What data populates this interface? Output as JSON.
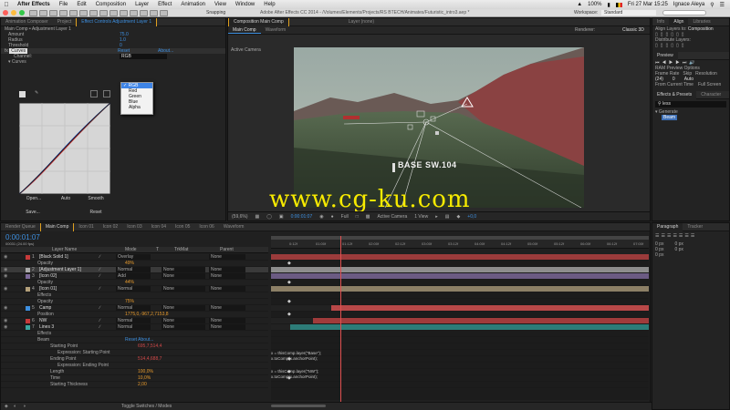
{
  "menubar": {
    "apple": "",
    "app": "After Effects",
    "items": [
      "File",
      "Edit",
      "Composition",
      "Layer",
      "Effect",
      "Animation",
      "View",
      "Window",
      "Help"
    ],
    "battery": "100%",
    "date": "Fri 27 Mar 15:25",
    "user": "Ignace Aleya"
  },
  "titlebar": {
    "title": "Adobe After Effects CC 2014 - /Volumes/Elements/Projects/RS BTECH/Animates/Futuristic_intro3.aep *",
    "snapping": "Snapping",
    "workspace_label": "Workspace:",
    "workspace_value": "Standard"
  },
  "left_panel": {
    "tabs": [
      "Animation Composer",
      "Project",
      "Effect Controls Adjustment Layer 1"
    ],
    "header": "Main Comp • Adjustment Layer 1",
    "props": [
      {
        "label": "Amount",
        "value": "75.0"
      },
      {
        "label": "Radius",
        "value": "1.0"
      },
      {
        "label": "Threshold",
        "value": "0"
      }
    ],
    "fx_curves": "Curves",
    "reset": "Reset",
    "about": "About...",
    "channel_label": "Channel:",
    "channel_value": "RGB",
    "curves_label": "Curves",
    "channel_options": [
      "RGB",
      "Red",
      "Green",
      "Blue",
      "Alpha"
    ],
    "buttons": {
      "open": "Open...",
      "auto": "Auto",
      "smooth": "Smooth",
      "save": "Save...",
      "reset": "Reset"
    }
  },
  "composition": {
    "tabs": [
      "Composition Main Comp",
      "Layer (none)"
    ],
    "subtabs": [
      "Main Comp",
      "Waveform"
    ],
    "renderer_label": "Renderer:",
    "renderer_value": "Classic 3D",
    "active_camera": "Active Camera",
    "overlay_text": "BASE SW.104",
    "watermark": "www.cg-ku.com",
    "footer": {
      "zoom": "(59,6%)",
      "timecode": "0:00:01:07",
      "quality": "Full",
      "camera": "Active Camera",
      "views": "1 View",
      "offset": "+0,0"
    }
  },
  "right_panel": {
    "tabs": [
      "Info",
      "Align",
      "Libraries"
    ],
    "align_to_label": "Align Layers to:",
    "align_to_value": "Composition",
    "distribute": "Distribute Layers:",
    "preview_tab": "Preview",
    "ram_options": "RAM Preview Options",
    "frame_rate": "Frame Rate",
    "skip": "Skip",
    "resolution": "Resolution",
    "frame_rate_value": "(24)",
    "skip_value": "0",
    "resolution_value": "Auto",
    "from_current": "From Current Time",
    "full_screen": "Full Screen",
    "effects_tab": "Effects & Presets",
    "character_tab": "Character",
    "search_value": "less",
    "generate": "Generate",
    "result": "Beam",
    "paragraph_tab": "Paragraph",
    "tracker_tab": "Tracker",
    "px": [
      "0 px",
      "0 px",
      "0 px",
      "0 px",
      "0 px"
    ]
  },
  "timeline": {
    "tabs": [
      "Render Queue",
      "Main Comp",
      "Icon 01",
      "Icon 02",
      "Icon 03",
      "Icon 04",
      "Icon 05",
      "Icon 06",
      "Waveform"
    ],
    "timecode": "0:00:01:07",
    "frame": "00031 (24.00 fps)",
    "columns": [
      "Layer Name",
      "Mode",
      "T",
      "TrkMat",
      "Parent"
    ],
    "layers": [
      {
        "num": "1",
        "name": "[Black Solid 1]",
        "color": "#c73a3a",
        "mode": "Overlay",
        "trk": "",
        "parent": "None",
        "sel": false
      },
      {
        "num": "",
        "name": "Opacity",
        "value": "49%",
        "prop": true
      },
      {
        "num": "2",
        "name": "[Adjustment Layer 1]",
        "color": "#aaaaaa",
        "mode": "Normal",
        "trk": "None",
        "parent": "None",
        "sel": true
      },
      {
        "num": "3",
        "name": "[Icon 02]",
        "color": "#7d6a9b",
        "mode": "Add",
        "trk": "None",
        "parent": "None",
        "sel": false
      },
      {
        "num": "",
        "name": "Opacity",
        "value": "44%",
        "prop": true
      },
      {
        "num": "4",
        "name": "[Icon 01]",
        "color": "#b3a07a",
        "mode": "Normal",
        "trk": "None",
        "parent": "None",
        "sel": false
      },
      {
        "num": "",
        "name": "Effects",
        "value": "",
        "prop": true
      },
      {
        "num": "",
        "name": "Opacity",
        "value": "75%",
        "prop": true
      },
      {
        "num": "5",
        "name": "Camp",
        "color": "#3d8fe0",
        "mode": "Normal",
        "trk": "None",
        "parent": "None",
        "sel": false
      },
      {
        "num": "",
        "name": "Position",
        "value": "1775,0,-967,2,7153,8",
        "prop": true
      },
      {
        "num": "6",
        "name": "NW",
        "color": "#c73a3a",
        "mode": "Normal",
        "trk": "None",
        "parent": "None",
        "sel": false
      },
      {
        "num": "7",
        "name": "Lines 3",
        "color": "#3aa7a0",
        "mode": "Normal",
        "trk": "None",
        "parent": "None",
        "sel": false
      },
      {
        "num": "",
        "name": "Effects",
        "value": "",
        "prop": true
      },
      {
        "num": "",
        "name": "Beam",
        "value": "Reset    About...",
        "prop": true
      },
      {
        "num": "",
        "name": "Starting Point",
        "value": "695,7,514,4",
        "prop": true
      },
      {
        "num": "",
        "name": "Expression: Starting Point",
        "value": "",
        "prop": true
      },
      {
        "num": "",
        "name": "Ending Point",
        "value": "514,4,688,7",
        "prop": true
      },
      {
        "num": "",
        "name": "Expression: Ending Point",
        "value": "",
        "prop": true
      },
      {
        "num": "",
        "name": "Length",
        "value": "100,0%",
        "prop": true
      },
      {
        "num": "",
        "name": "Time",
        "value": "10,0%",
        "prop": true
      },
      {
        "num": "",
        "name": "Starting Thickness",
        "value": "2,00",
        "prop": true
      }
    ],
    "ruler": [
      "0:12f",
      "01:00f",
      "01:12f",
      "02:00f",
      "02:12f",
      "03:00f",
      "03:12f",
      "04:00f",
      "04:12f",
      "05:00f",
      "05:12f",
      "06:00f",
      "06:12f",
      "07:00f"
    ],
    "expr1": [
      "x = thisComp.layer(\"Base\");",
      "x.toComp(x.anchorPoint);"
    ],
    "expr2": [
      "x = thisComp.layer(\"NW\");",
      "x.toComp(x.anchorPoint);"
    ],
    "toggle": "Toggle Switches / Modes"
  }
}
